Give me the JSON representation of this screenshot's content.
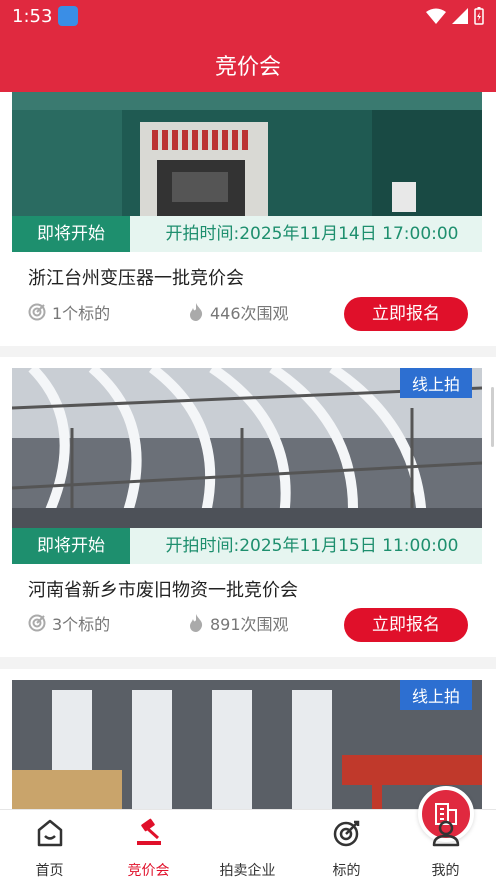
{
  "status_bar": {
    "time": "1:53"
  },
  "app_bar": {
    "title": "竞价会"
  },
  "auctions": [
    {
      "status": "即将开始",
      "time_text": "开拍时间:2025年11月14日 17:00:00",
      "name": "浙江台州变压器一批竞价会",
      "lots": "1个标的",
      "views": "446次围观",
      "button": "立即报名"
    },
    {
      "tag": "线上拍",
      "status": "即将开始",
      "time_text": "开拍时间:2025年11月15日 11:00:00",
      "name": "河南省新乡市废旧物资一批竞价会",
      "lots": "3个标的",
      "views": "891次围观",
      "button": "立即报名"
    },
    {
      "tag": "线上拍"
    }
  ],
  "tabs": [
    {
      "label": "首页"
    },
    {
      "label": "竞价会"
    },
    {
      "label": "拍卖企业"
    },
    {
      "label": "标的"
    },
    {
      "label": "我的"
    }
  ],
  "colors": {
    "brand_red": "#e0293f",
    "button_red": "#e0102a",
    "status_green": "#1e8f6e",
    "online_blue": "#2d6fd1"
  }
}
